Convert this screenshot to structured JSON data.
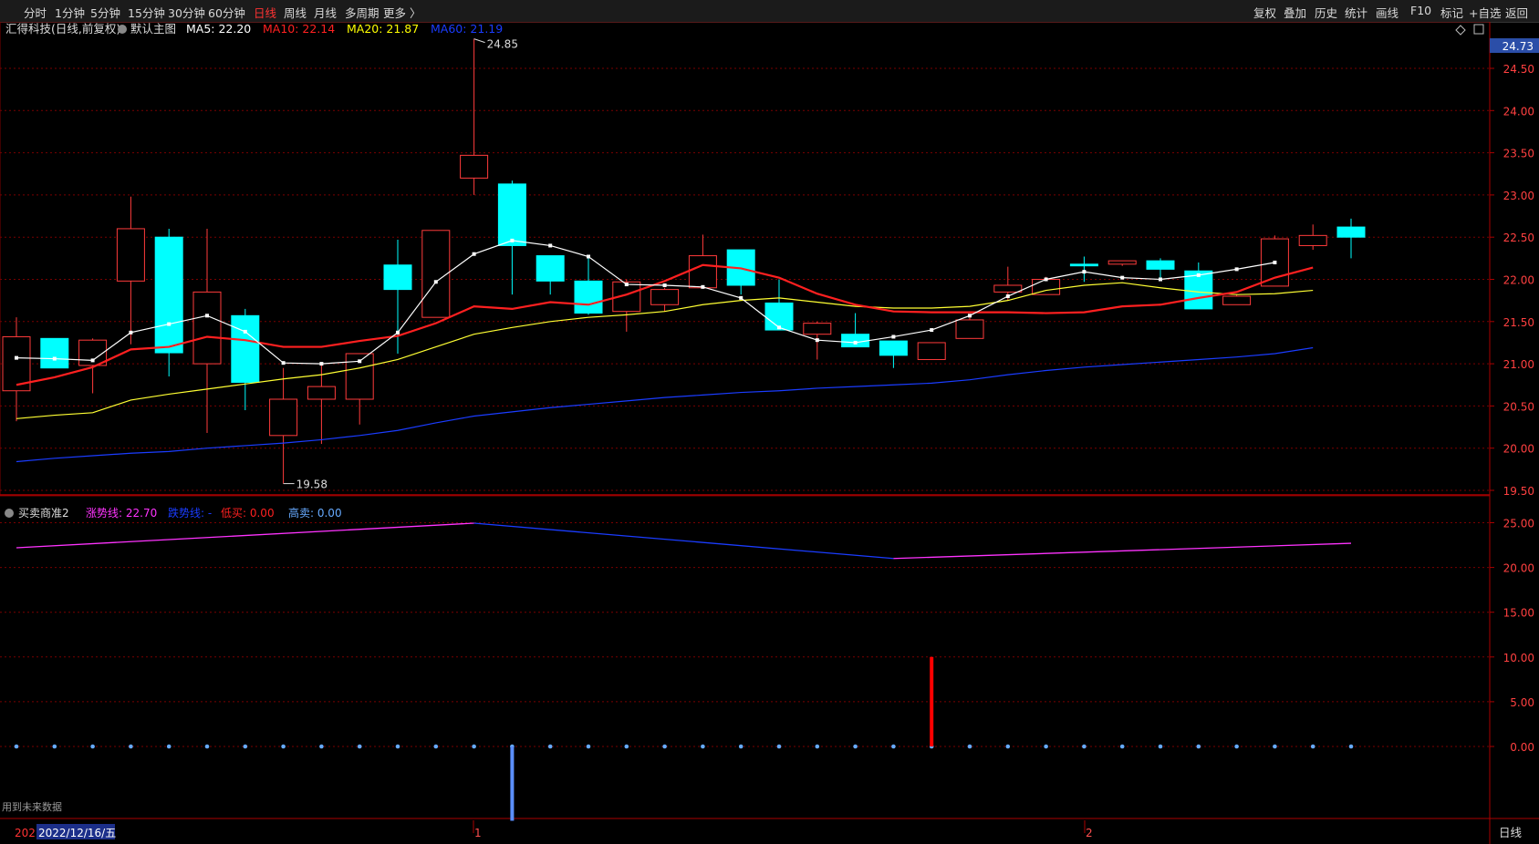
{
  "toolbar": {
    "left": [
      "分时",
      "1分钟",
      "5分钟",
      "15分钟",
      "30分钟",
      "60分钟",
      "日线",
      "周线",
      "月线",
      "多周期",
      "更多 〉"
    ],
    "active": "日线",
    "right": [
      "复权",
      "叠加",
      "历史",
      "统计",
      "画线",
      "F10",
      "标记",
      "+自选",
      "返回"
    ]
  },
  "main_header": {
    "title": "汇得科技(日线,前复权)",
    "template": "默认主图",
    "items": [
      {
        "label": "MA5: 22.20",
        "color": "#ffffff"
      },
      {
        "label": "MA10: 22.14",
        "color": "#ff2020"
      },
      {
        "label": "MA20: 21.87",
        "color": "#ffff00"
      },
      {
        "label": "MA60: 21.19",
        "color": "#1a3cff"
      }
    ]
  },
  "sub_header": {
    "title": "买卖商准2",
    "items": [
      {
        "label": "涨势线: 22.70",
        "color": "#ff33ff"
      },
      {
        "label": "跌势线: -",
        "color": "#1a3cff"
      },
      {
        "label": "低买: 0.00",
        "color": "#ff2020"
      },
      {
        "label": "高卖: 0.00",
        "color": "#66aaff"
      }
    ]
  },
  "icons": {
    "diamond": "diamond-icon",
    "toggle": "panel-toggle-icon",
    "collapse": "collapse-icon"
  },
  "annotations": {
    "high": "24.85",
    "low": "19.58"
  },
  "price_tag": "24.73",
  "future_note": "用到未来数据",
  "bottom": {
    "date": "2022/12/16/五",
    "year_prefix": "202",
    "month1": "1",
    "month2": "2",
    "period": "日线"
  },
  "colors": {
    "up": "#ff3b3b",
    "down": "#00ffff",
    "bg": "#000000",
    "grid": "#7a0000"
  },
  "chart_data": {
    "type": "candlestick",
    "price_axis": {
      "ticks": [
        19.5,
        20.0,
        20.5,
        21.0,
        21.5,
        22.0,
        22.5,
        23.0,
        23.5,
        24.0,
        24.5
      ]
    },
    "candles": [
      {
        "o": 20.68,
        "h": 21.55,
        "l": 20.32,
        "c": 21.32
      },
      {
        "o": 21.3,
        "h": 21.3,
        "l": 20.95,
        "c": 20.95
      },
      {
        "o": 20.98,
        "h": 21.3,
        "l": 20.65,
        "c": 21.28
      },
      {
        "o": 21.98,
        "h": 22.98,
        "l": 21.23,
        "c": 22.6
      },
      {
        "o": 22.5,
        "h": 22.6,
        "l": 20.85,
        "c": 21.13
      },
      {
        "o": 21.0,
        "h": 22.6,
        "l": 20.18,
        "c": 21.85
      },
      {
        "o": 21.57,
        "h": 21.65,
        "l": 20.45,
        "c": 20.78
      },
      {
        "o": 20.15,
        "h": 20.95,
        "l": 19.58,
        "c": 20.58
      },
      {
        "o": 20.58,
        "h": 21.0,
        "l": 20.05,
        "c": 20.73
      },
      {
        "o": 20.58,
        "h": 21.1,
        "l": 20.28,
        "c": 21.12
      },
      {
        "o": 22.17,
        "h": 22.47,
        "l": 21.12,
        "c": 21.88
      },
      {
        "o": 21.55,
        "h": 22.58,
        "l": 21.55,
        "c": 22.58
      },
      {
        "o": 23.2,
        "h": 24.85,
        "l": 23.0,
        "c": 23.47
      },
      {
        "o": 23.13,
        "h": 23.17,
        "l": 21.82,
        "c": 22.4
      },
      {
        "o": 22.28,
        "h": 22.28,
        "l": 21.82,
        "c": 21.98
      },
      {
        "o": 21.98,
        "h": 22.25,
        "l": 21.58,
        "c": 21.6
      },
      {
        "o": 21.62,
        "h": 22.0,
        "l": 21.38,
        "c": 21.97
      },
      {
        "o": 21.7,
        "h": 21.9,
        "l": 21.62,
        "c": 21.88
      },
      {
        "o": 21.9,
        "h": 22.53,
        "l": 21.9,
        "c": 22.28
      },
      {
        "o": 22.35,
        "h": 22.35,
        "l": 21.82,
        "c": 21.93
      },
      {
        "o": 21.72,
        "h": 22.0,
        "l": 21.4,
        "c": 21.4
      },
      {
        "o": 21.35,
        "h": 21.5,
        "l": 21.05,
        "c": 21.48
      },
      {
        "o": 21.35,
        "h": 21.6,
        "l": 21.2,
        "c": 21.2
      },
      {
        "o": 21.27,
        "h": 21.27,
        "l": 20.95,
        "c": 21.1
      },
      {
        "o": 21.05,
        "h": 21.25,
        "l": 21.05,
        "c": 21.25
      },
      {
        "o": 21.3,
        "h": 21.55,
        "l": 21.3,
        "c": 21.52
      },
      {
        "o": 21.85,
        "h": 22.15,
        "l": 21.75,
        "c": 21.93
      },
      {
        "o": 21.82,
        "h": 22.03,
        "l": 21.82,
        "c": 22.0
      },
      {
        "o": 22.18,
        "h": 22.27,
        "l": 21.97,
        "c": 22.16
      },
      {
        "o": 22.18,
        "h": 22.22,
        "l": 22.16,
        "c": 22.22
      },
      {
        "o": 22.22,
        "h": 22.25,
        "l": 22.0,
        "c": 22.12
      },
      {
        "o": 22.1,
        "h": 22.2,
        "l": 21.65,
        "c": 21.65
      },
      {
        "o": 21.7,
        "h": 21.82,
        "l": 21.7,
        "c": 21.8
      },
      {
        "o": 21.92,
        "h": 22.52,
        "l": 21.92,
        "c": 22.48
      },
      {
        "o": 22.4,
        "h": 22.65,
        "l": 22.35,
        "c": 22.52
      },
      {
        "o": 22.62,
        "h": 22.72,
        "l": 22.25,
        "c": 22.5
      }
    ],
    "ma5": [
      21.07,
      21.06,
      21.04,
      21.37,
      21.47,
      21.57,
      21.38,
      21.01,
      21.0,
      21.03,
      21.37,
      21.97,
      22.3,
      22.46,
      22.4,
      22.27,
      21.94,
      21.93,
      21.91,
      21.78,
      21.43,
      21.28,
      21.25,
      21.32,
      21.4,
      21.57,
      21.8,
      22.0,
      22.09,
      22.02,
      22.0,
      22.05,
      22.12,
      22.2
    ],
    "ma10": [
      20.75,
      20.84,
      20.96,
      21.17,
      21.2,
      21.32,
      21.28,
      21.2,
      21.2,
      21.27,
      21.33,
      21.48,
      21.68,
      21.65,
      21.73,
      21.7,
      21.82,
      21.98,
      22.17,
      22.13,
      22.02,
      21.83,
      21.7,
      21.62,
      21.61,
      21.61,
      21.61,
      21.6,
      21.61,
      21.68,
      21.7,
      21.78,
      21.85,
      22.02,
      22.14
    ],
    "ma20": [
      20.35,
      20.39,
      20.42,
      20.57,
      20.64,
      20.7,
      20.76,
      20.82,
      20.87,
      20.95,
      21.05,
      21.2,
      21.35,
      21.43,
      21.5,
      21.55,
      21.58,
      21.62,
      21.7,
      21.75,
      21.78,
      21.73,
      21.68,
      21.66,
      21.66,
      21.68,
      21.75,
      21.87,
      21.93,
      21.96,
      21.9,
      21.85,
      21.82,
      21.83,
      21.87
    ],
    "ma60": [
      19.84,
      19.88,
      19.91,
      19.94,
      19.96,
      20.0,
      20.03,
      20.06,
      20.1,
      20.15,
      20.21,
      20.3,
      20.38,
      20.43,
      20.48,
      20.52,
      20.56,
      20.6,
      20.63,
      20.66,
      20.68,
      20.71,
      20.73,
      20.75,
      20.77,
      20.81,
      20.87,
      20.92,
      20.96,
      20.99,
      21.02,
      21.05,
      21.08,
      21.12,
      21.19
    ],
    "indicator": {
      "axis_ticks": [
        0,
        5,
        10,
        15,
        20,
        25
      ],
      "rise_line": {
        "color": "#ff33ff",
        "points": [
          [
            0,
            22.2
          ],
          [
            12,
            24.95
          ],
          [
            35,
            22.7
          ]
        ]
      },
      "fall_line": {
        "color": "#1a3cff",
        "points": [
          [
            12,
            24.95
          ],
          [
            23,
            21.0
          ]
        ]
      },
      "rise_line2": {
        "color": "#ff33ff",
        "points": [
          [
            23,
            21.0
          ],
          [
            35,
            22.7
          ]
        ]
      },
      "low_buy": [
        {
          "i": 24,
          "v": 10.0
        }
      ],
      "high_sell": [
        {
          "i": 13,
          "v": -8.3
        }
      ],
      "zero_dots": "all"
    }
  }
}
